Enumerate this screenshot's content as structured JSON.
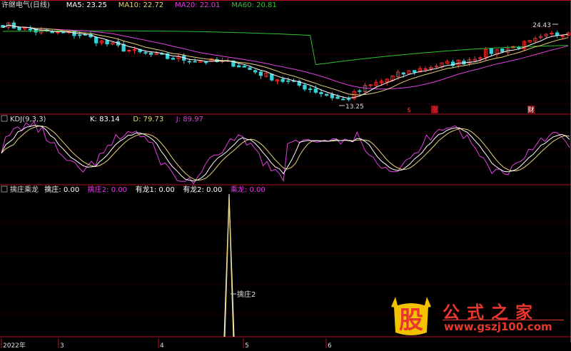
{
  "chart_data": [
    {
      "type": "candlestick",
      "title": "许继电气(日线)",
      "series": [
        {
          "name": "MA5",
          "value_text": "23.25",
          "color": "#ffffff"
        },
        {
          "name": "MA10",
          "value_text": "22.72",
          "color": "#e6d27a"
        },
        {
          "name": "MA20",
          "value_text": "22.01",
          "color": "#e040e0"
        },
        {
          "name": "MA60",
          "value_text": "20.81",
          "color": "#30c030"
        }
      ],
      "annotations": {
        "high": "24.43",
        "low": "13.25"
      },
      "event_markers": [
        "$",
        "涨",
        "财"
      ]
    },
    {
      "type": "line",
      "title": "KDJ(9,3,3)",
      "series": [
        {
          "name": "K",
          "value_text": "83.14",
          "color": "#ffffff"
        },
        {
          "name": "D",
          "value_text": "79.73",
          "color": "#e6d27a"
        },
        {
          "name": "J",
          "value_text": "89.97",
          "color": "#e040e0"
        }
      ]
    },
    {
      "type": "line",
      "title": "擒庄乘龙",
      "series": [
        {
          "name": "擒庄",
          "value_text": "0.00",
          "color": "#ffffff"
        },
        {
          "name": "擒庄2",
          "value_text": "0.00",
          "color": "#e040e0"
        },
        {
          "name": "有龙1",
          "value_text": "0.00",
          "color": "#ffffff"
        },
        {
          "name": "有龙2",
          "value_text": "0.00",
          "color": "#ffffff"
        },
        {
          "name": "乘龙",
          "value_text": "0.00",
          "color": "#e040e0"
        }
      ],
      "annotations": {
        "spike_label": "擒庄2"
      }
    }
  ],
  "x_axis": {
    "labels": [
      "2022年",
      "3",
      "4",
      "5",
      "6"
    ]
  },
  "watermark": {
    "title": "公式之家",
    "url": "www.gszj100.com",
    "logo_text": "股"
  }
}
